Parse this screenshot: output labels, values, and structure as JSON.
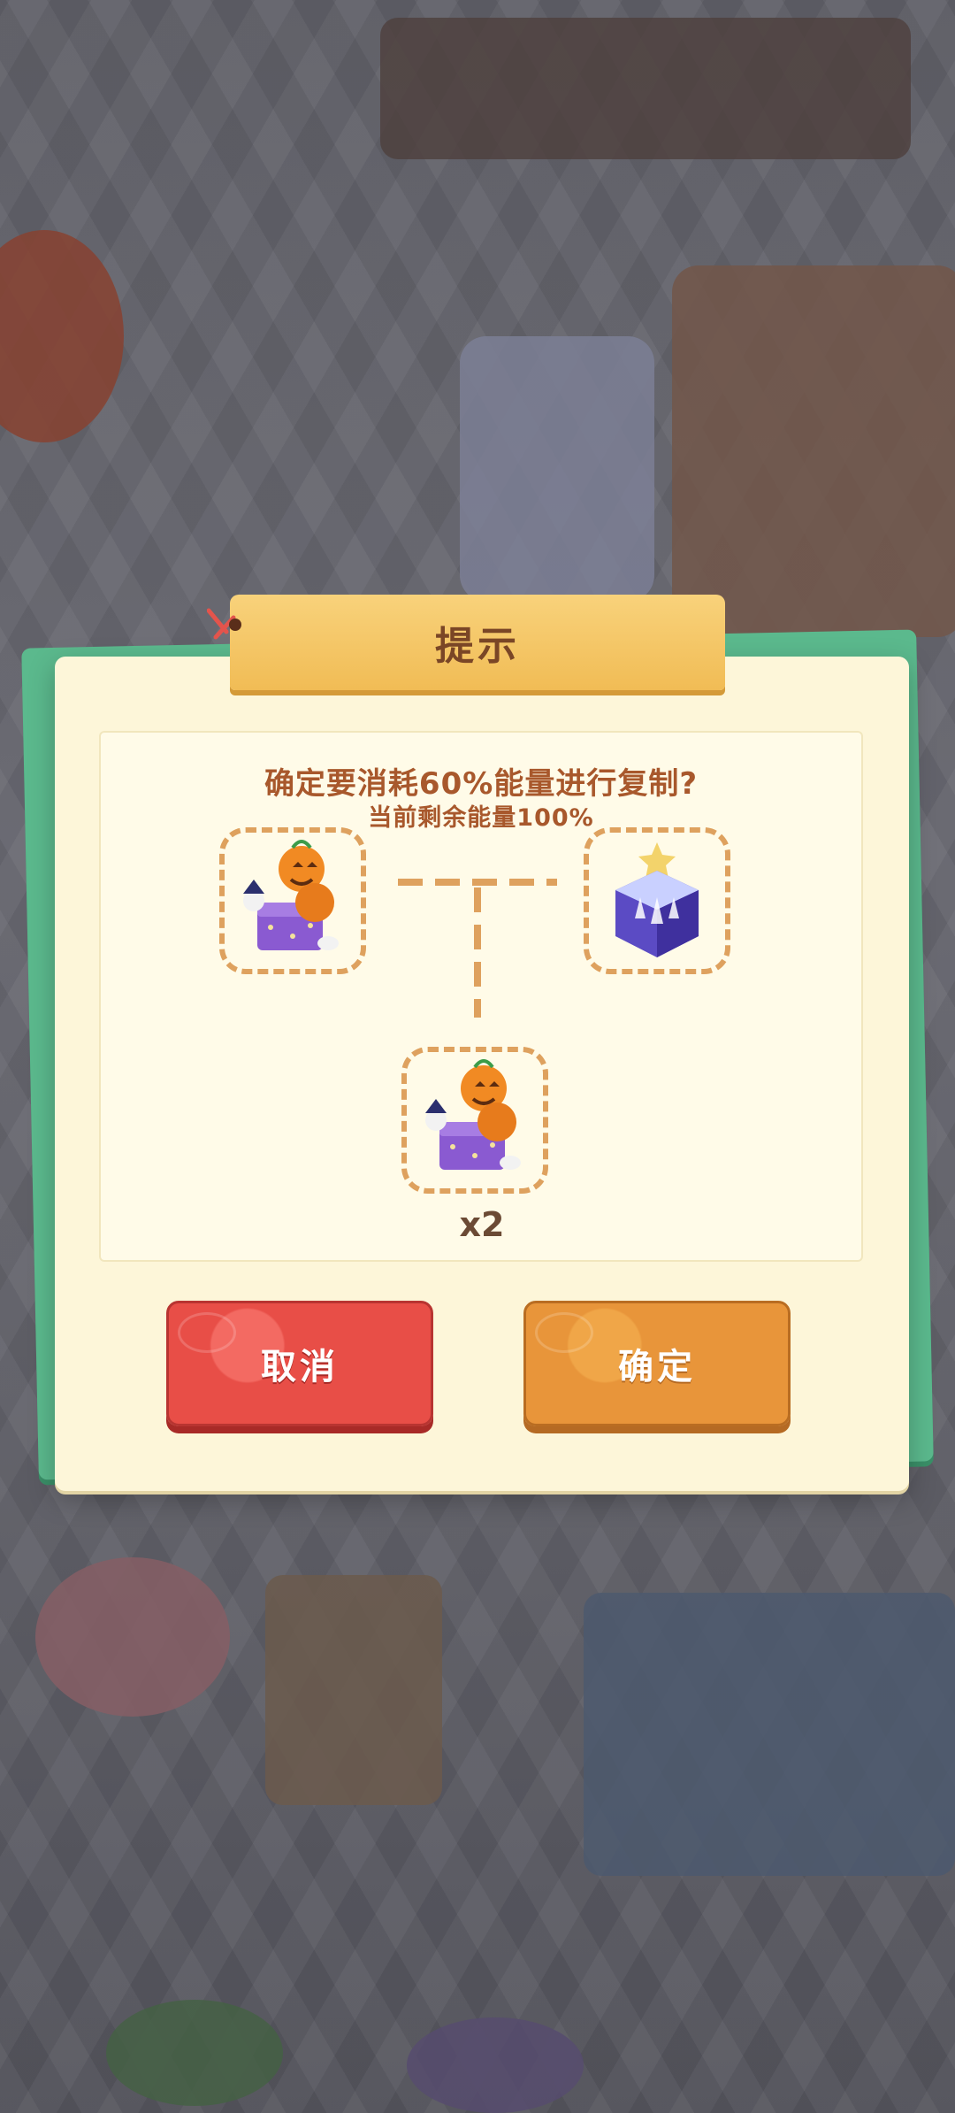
{
  "dialog": {
    "title": "提示",
    "question": "确定要消耗60%能量进行复制?",
    "energy_remaining": "当前剩余能量100%",
    "quantity": "x2"
  },
  "buttons": {
    "cancel_label": "取消",
    "confirm_label": "确定"
  },
  "colors": {
    "dialog_bg": "#fdf6d9",
    "title_tab": "#f1bc55",
    "text_brown": "#a8582c",
    "slot_border": "#dea15e",
    "cancel_red": "#e84e47",
    "confirm_orange": "#e8953a",
    "back_panel_green": "#5bb98d"
  },
  "icons": {
    "source_item": "halloween-pumpkin-gift-icon",
    "energy_item": "crystal-castle-icon",
    "result_item": "halloween-pumpkin-gift-icon"
  }
}
